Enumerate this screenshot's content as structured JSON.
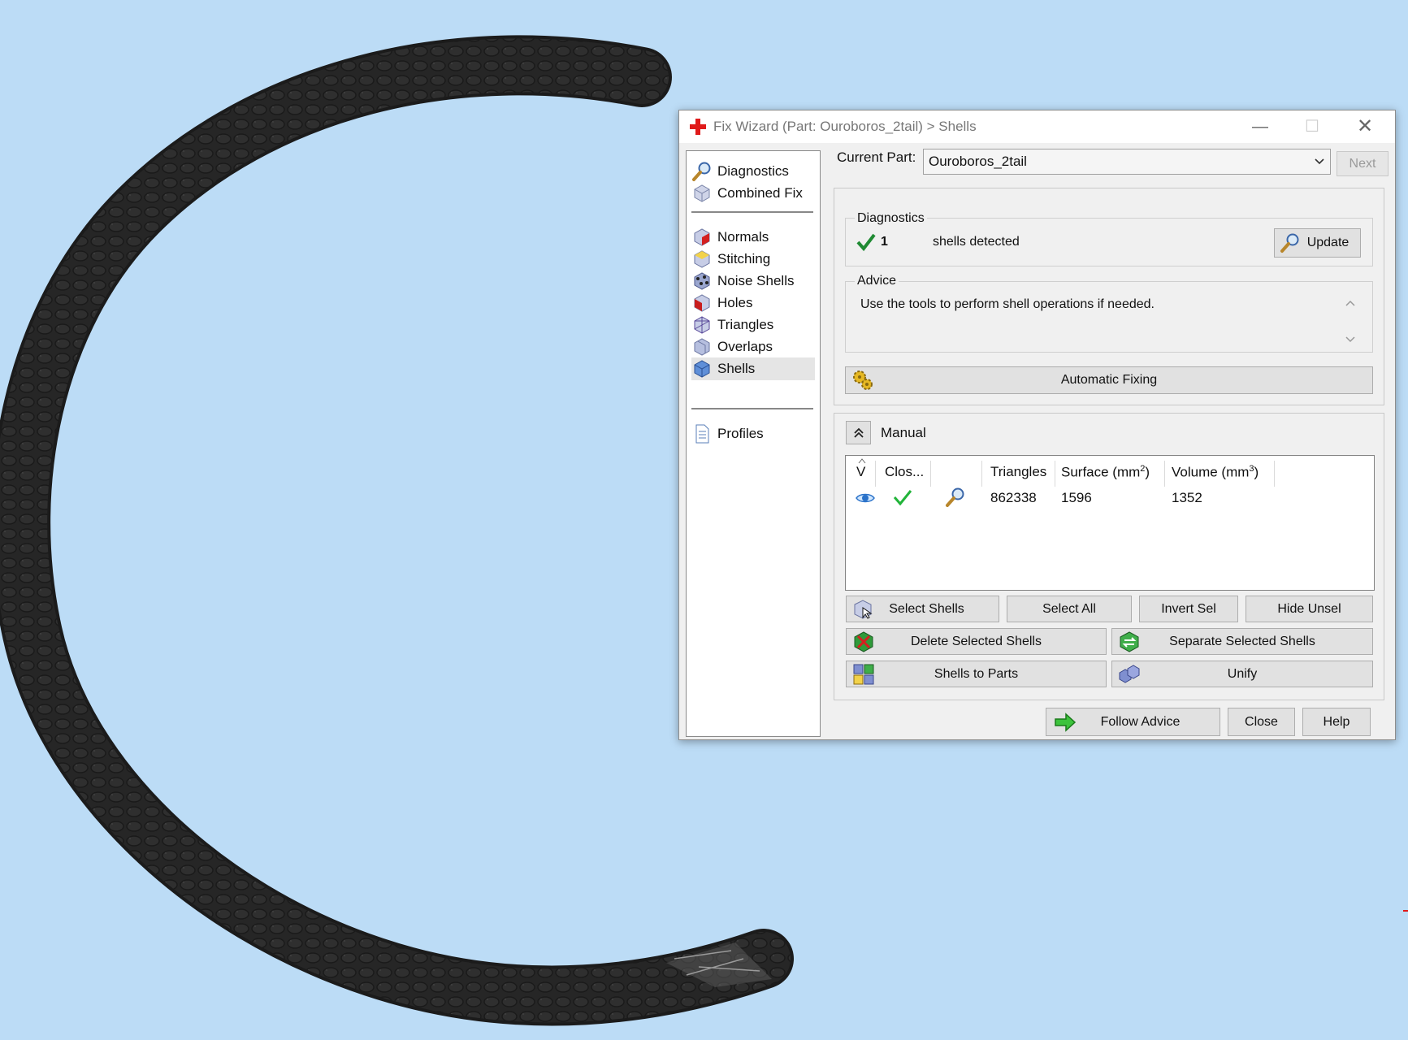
{
  "dialog": {
    "title": "Fix Wizard (Part: Ouroboros_2tail) > Shells",
    "window_controls": {
      "minimize": "—",
      "maximize": "☐",
      "close": "✕"
    }
  },
  "sidebar": {
    "items": [
      {
        "label": "Diagnostics",
        "icon": "magnifier-icon"
      },
      {
        "label": "Combined Fix",
        "icon": "cube-icon"
      },
      {
        "label": "Normals",
        "icon": "normals-cube-icon"
      },
      {
        "label": "Stitching",
        "icon": "stitching-cube-icon"
      },
      {
        "label": "Noise Shells",
        "icon": "noise-shells-icon"
      },
      {
        "label": "Holes",
        "icon": "holes-cube-icon"
      },
      {
        "label": "Triangles",
        "icon": "triangles-cube-icon"
      },
      {
        "label": "Overlaps",
        "icon": "overlaps-cube-icon"
      },
      {
        "label": "Shells",
        "icon": "shells-cube-icon",
        "active": true
      },
      {
        "label": "Profiles",
        "icon": "profile-document-icon"
      }
    ]
  },
  "current_part": {
    "label": "Current Part:",
    "value": "Ouroboros_2tail",
    "next_label": "Next"
  },
  "diagnostics": {
    "title": "Diagnostics",
    "count": "1",
    "message": "shells detected",
    "update_label": "Update"
  },
  "advice": {
    "title": "Advice",
    "text": "Use the tools to perform shell operations if needed."
  },
  "automatic_fixing_label": "Automatic Fixing",
  "manual": {
    "title": "Manual",
    "table": {
      "headers": {
        "v": "V",
        "closed": "Clos...",
        "triangles": "Triangles",
        "surface": "Surface (mm",
        "surface_sup": "2",
        "surface_close": ")",
        "volume": "Volume (mm",
        "volume_sup": "3",
        "volume_close": ")"
      },
      "rows": [
        {
          "visible": "eye-icon",
          "closed": "checkmark-icon",
          "detail": "magnifier-icon",
          "triangles": "862338",
          "surface": "1596",
          "volume": "1352"
        }
      ]
    },
    "buttons": {
      "select_shells": "Select Shells",
      "select_all": "Select All",
      "invert_sel": "Invert Sel",
      "hide_unsel": "Hide Unsel",
      "delete_selected": "Delete Selected Shells",
      "separate_selected": "Separate Selected Shells",
      "shells_to_parts": "Shells to Parts",
      "unify": "Unify"
    }
  },
  "footer": {
    "follow_advice": "Follow Advice",
    "close": "Close",
    "help": "Help"
  },
  "colors": {
    "viewport_bg": "#bcdcf6",
    "model": "#262626",
    "check_green": "#22a83a",
    "accent_red": "#e01a1a"
  }
}
